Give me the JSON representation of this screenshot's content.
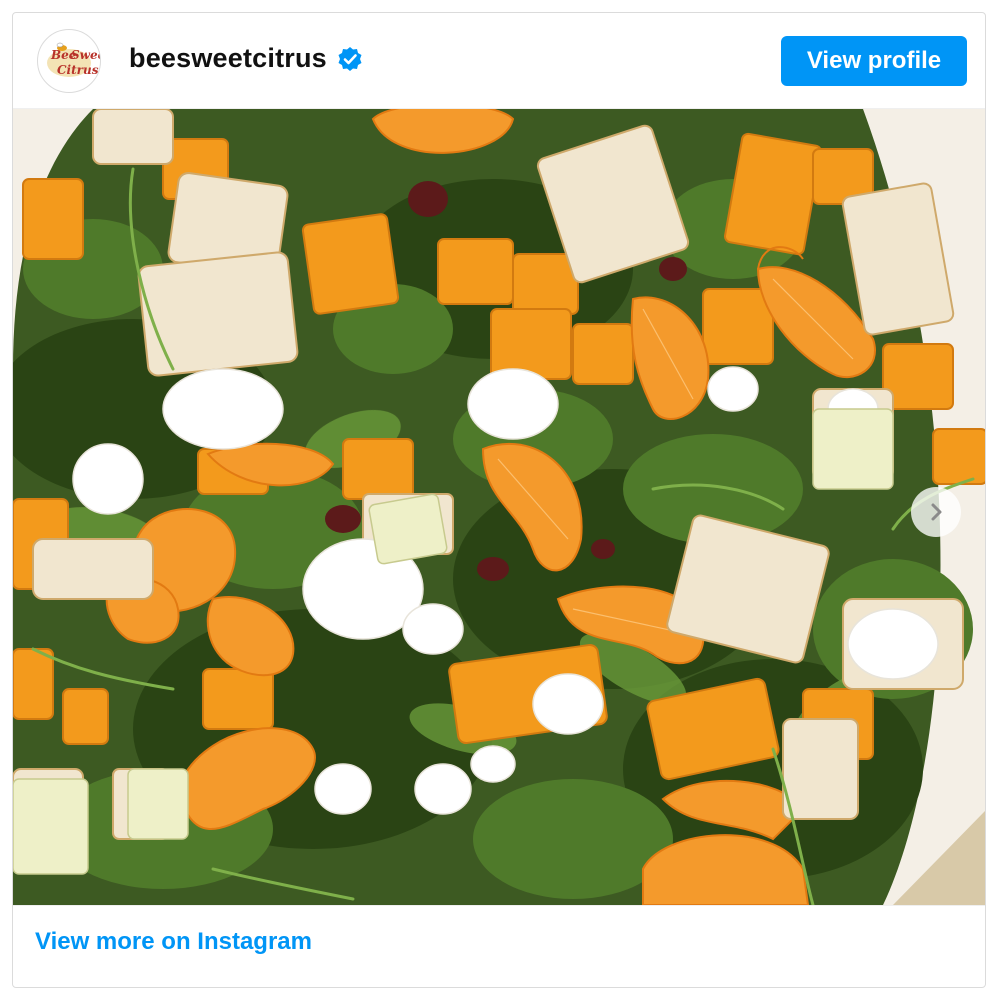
{
  "header": {
    "username": "beesweetcitrus",
    "verified_icon": "verified-badge-icon",
    "view_profile_label": "View profile",
    "avatar_icon": "bee-sweet-citrus-logo"
  },
  "post": {
    "image_alt": "Kale salad with mandarin segments, roasted squash, croutons, feta and cranberries",
    "next_icon": "chevron-right-icon"
  },
  "footer": {
    "link_label": "View more on Instagram"
  },
  "colors": {
    "accent": "#0095f6",
    "verified": "#0095f6"
  }
}
